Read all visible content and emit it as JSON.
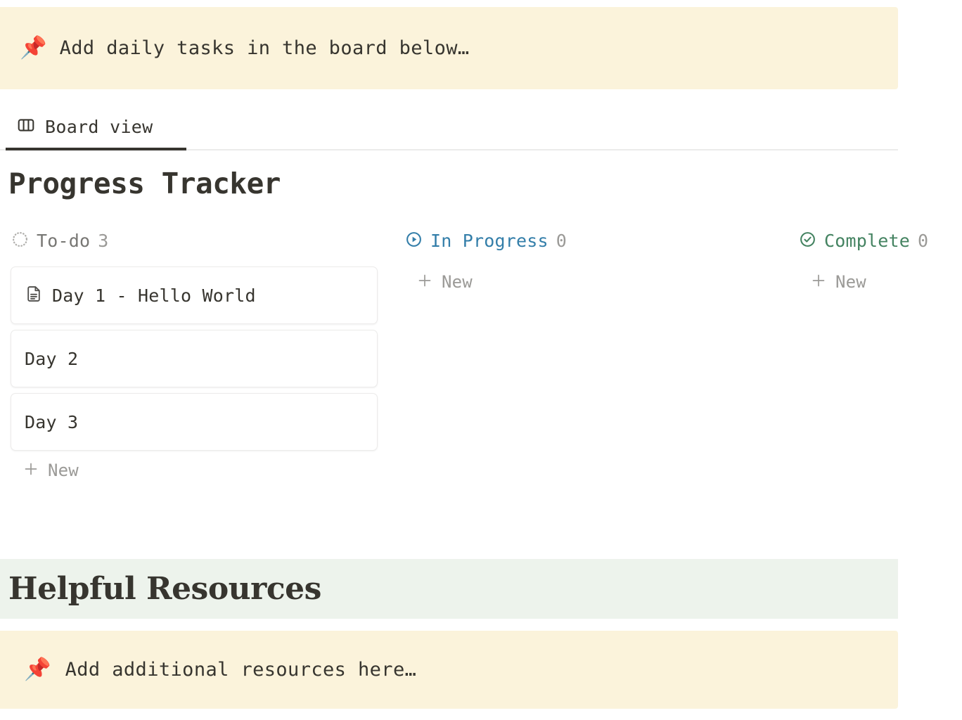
{
  "top_callout": {
    "emoji": "📌",
    "icon_name": "pushpin-emoji",
    "text": "Add daily tasks in the board below…",
    "background": "#FBF3DB"
  },
  "tabs": [
    {
      "label": "Board view",
      "icon": "board-view-icon",
      "active": true
    }
  ],
  "page_title": "Progress Tracker",
  "board": {
    "columns": [
      {
        "name": "To-do",
        "count": "3",
        "color": "#787774",
        "icon": "dotted-circle-icon",
        "new_label": "New",
        "cards": [
          {
            "title": "Day 1 - Hello World",
            "icon": "page-icon",
            "has_icon": true
          },
          {
            "title": "Day 2",
            "icon": "",
            "has_icon": false
          },
          {
            "title": "Day 3",
            "icon": "",
            "has_icon": false
          }
        ]
      },
      {
        "name": "In Progress",
        "count": "0",
        "color": "#337EA9",
        "icon": "play-circle-icon",
        "new_label": "New",
        "cards": []
      },
      {
        "name": "Complete",
        "count": "0",
        "color": "#448361",
        "icon": "check-circle-icon",
        "new_label": "New",
        "cards": []
      }
    ]
  },
  "section": {
    "title": "Helpful Resources",
    "background": "#EDF3EC"
  },
  "bottom_callout": {
    "emoji": "📌",
    "icon_name": "pushpin-emoji",
    "text": "Add additional resources here…",
    "background": "#FBF3DB"
  }
}
